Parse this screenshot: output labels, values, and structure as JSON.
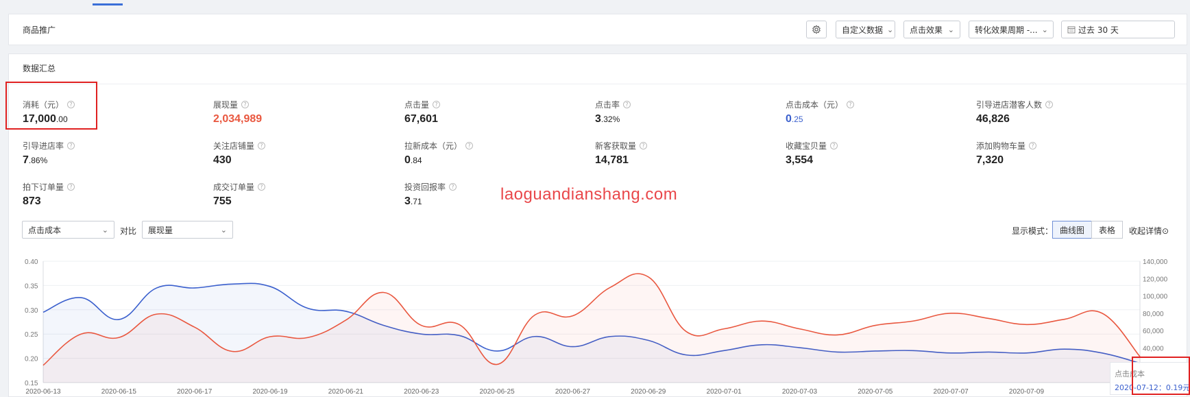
{
  "header": {
    "title": "商品推广",
    "toolbar": {
      "settings_icon": "gear-icon",
      "custom_data": "自定义数据",
      "click_effect": "点击效果",
      "conversion_period": "转化效果周期 -...",
      "date_range": "过去 30 天",
      "chevron_icon": "chevron-down-icon",
      "calendar_icon": "calendar-icon"
    }
  },
  "summary": {
    "title": "数据汇总",
    "metrics": [
      {
        "label": "消耗（元）",
        "int": "17,000",
        "dec": ".00",
        "color": "#222222"
      },
      {
        "label": "展现量",
        "int": "2,034,989",
        "dec": "",
        "color": "#e9573f"
      },
      {
        "label": "点击量",
        "int": "67,601",
        "dec": "",
        "color": "#222222"
      },
      {
        "label": "点击率",
        "int": "3",
        "dec": ".32%",
        "color": "#222222"
      },
      {
        "label": "点击成本（元）",
        "int": "0",
        "dec": ".25",
        "color": "#3a5fcd"
      },
      {
        "label": "引导进店潜客人数",
        "int": "46,826",
        "dec": "",
        "color": "#222222"
      },
      {
        "label": "引导进店率",
        "int": "7",
        "dec": ".86%",
        "color": "#222222"
      },
      {
        "label": "关注店铺量",
        "int": "430",
        "dec": "",
        "color": "#222222"
      },
      {
        "label": "拉新成本（元）",
        "int": "0",
        "dec": ".84",
        "color": "#222222"
      },
      {
        "label": "新客获取量",
        "int": "14,781",
        "dec": "",
        "color": "#222222"
      },
      {
        "label": "收藏宝贝量",
        "int": "3,554",
        "dec": "",
        "color": "#222222"
      },
      {
        "label": "添加购物车量",
        "int": "7,320",
        "dec": "",
        "color": "#222222"
      },
      {
        "label": "拍下订单量",
        "int": "873",
        "dec": "",
        "color": "#222222"
      },
      {
        "label": "成交订单量",
        "int": "755",
        "dec": "",
        "color": "#222222"
      },
      {
        "label": "投资回报率",
        "int": "3",
        "dec": ".71",
        "color": "#222222"
      }
    ],
    "help_icon": "?"
  },
  "watermark": "laoguandianshang.com",
  "controls": {
    "metric1": "点击成本",
    "compare_label": "对比",
    "metric2": "展现量",
    "mode_label": "显示模式：",
    "mode_curve": "曲线图",
    "mode_table": "表格",
    "collapse": "收起详情",
    "collapse_icon": "⊙"
  },
  "tooltip": {
    "series": "点击成本",
    "value": "2020-07-12：0.19元"
  },
  "colors": {
    "cost_series": "#3a5fcd",
    "impression_series": "#e9573f"
  },
  "chart_data": {
    "type": "line",
    "x": [
      "2020-06-13",
      "2020-06-14",
      "2020-06-15",
      "2020-06-16",
      "2020-06-17",
      "2020-06-18",
      "2020-06-19",
      "2020-06-20",
      "2020-06-21",
      "2020-06-22",
      "2020-06-23",
      "2020-06-24",
      "2020-06-25",
      "2020-06-26",
      "2020-06-27",
      "2020-06-28",
      "2020-06-29",
      "2020-06-30",
      "2020-07-01",
      "2020-07-02",
      "2020-07-03",
      "2020-07-04",
      "2020-07-05",
      "2020-07-06",
      "2020-07-07",
      "2020-07-08",
      "2020-07-09",
      "2020-07-10",
      "2020-07-11",
      "2020-07-12"
    ],
    "x_tick_labels": [
      "2020-06-13",
      "2020-06-15",
      "2020-06-17",
      "2020-06-19",
      "2020-06-21",
      "2020-06-23",
      "2020-06-25",
      "2020-06-27",
      "2020-06-29",
      "2020-07-01",
      "2020-07-03",
      "2020-07-05",
      "2020-07-07",
      "2020-07-09"
    ],
    "series": [
      {
        "name": "点击成本",
        "axis": "left",
        "color": "#3a5fcd",
        "values": [
          0.295,
          0.325,
          0.28,
          0.345,
          0.345,
          0.353,
          0.348,
          0.303,
          0.297,
          0.268,
          0.25,
          0.247,
          0.215,
          0.245,
          0.224,
          0.245,
          0.237,
          0.207,
          0.216,
          0.228,
          0.222,
          0.213,
          0.215,
          0.216,
          0.211,
          0.213,
          0.211,
          0.219,
          0.211,
          0.19
        ]
      },
      {
        "name": "展现量",
        "axis": "right",
        "color": "#e9573f",
        "values": [
          20000,
          56000,
          52000,
          79000,
          64000,
          36000,
          53000,
          52000,
          72000,
          104000,
          66000,
          67000,
          21000,
          78000,
          77000,
          110000,
          122000,
          59000,
          62000,
          71000,
          62000,
          55000,
          66000,
          71000,
          80000,
          74000,
          67000,
          73000,
          80000,
          30000
        ]
      }
    ],
    "left_axis": {
      "min": 0.15,
      "max": 0.4,
      "ticks": [
        "0.40",
        "0.35",
        "0.30",
        "0.25",
        "0.20",
        "0.15"
      ]
    },
    "right_axis": {
      "min": 0,
      "max": 140000,
      "ticks": [
        "140,000",
        "120,000",
        "100,000",
        "80,000",
        "60,000",
        "40,000"
      ]
    },
    "grid": true
  }
}
